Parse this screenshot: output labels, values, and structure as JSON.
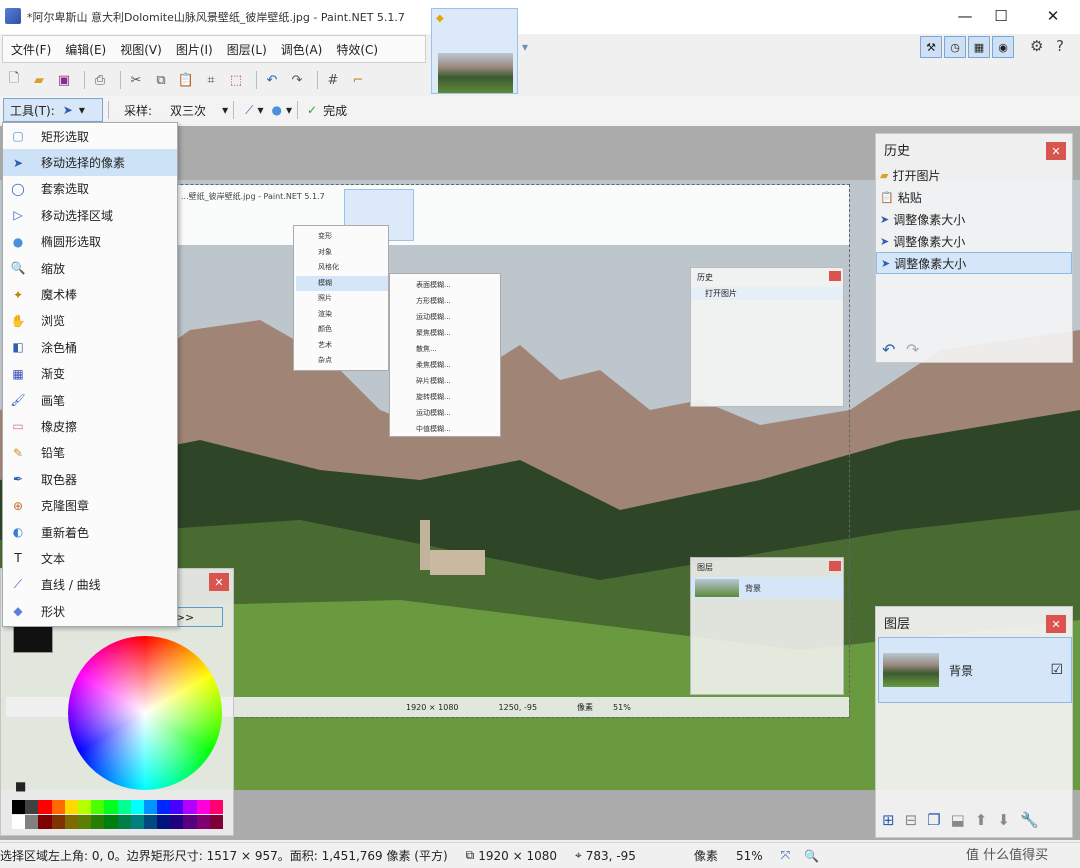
{
  "window": {
    "title": "*阿尔卑斯山 意大利Dolomite山脉风景壁纸_彼岸壁纸.jpg - Paint.NET 5.1.7",
    "minimize": "—",
    "maximize": "☐",
    "close": "✕"
  },
  "menu": [
    "文件(F)",
    "编辑(E)",
    "视图(V)",
    "图片(I)",
    "图层(L)",
    "调色(A)",
    "特效(C)"
  ],
  "toolbar2": {
    "tool_label": "工具(T):",
    "sampling_label": "采样:",
    "sampling_value": "双三次",
    "done_label": "完成"
  },
  "tools": [
    {
      "icon": "rect-select-icon",
      "label": "矩形选取"
    },
    {
      "icon": "move-pixels-icon",
      "label": "移动选择的像素"
    },
    {
      "icon": "lasso-icon",
      "label": "套索选取"
    },
    {
      "icon": "move-selection-icon",
      "label": "移动选择区域"
    },
    {
      "icon": "ellipse-select-icon",
      "label": "椭圆形选取"
    },
    {
      "icon": "zoom-icon",
      "label": "缩放"
    },
    {
      "icon": "magic-wand-icon",
      "label": "魔术棒"
    },
    {
      "icon": "pan-icon",
      "label": "浏览"
    },
    {
      "icon": "bucket-icon",
      "label": "涂色桶"
    },
    {
      "icon": "gradient-icon",
      "label": "渐变"
    },
    {
      "icon": "brush-icon",
      "label": "画笔"
    },
    {
      "icon": "eraser-icon",
      "label": "橡皮擦"
    },
    {
      "icon": "pencil-icon",
      "label": "铅笔"
    },
    {
      "icon": "picker-icon",
      "label": "取色器"
    },
    {
      "icon": "clone-stamp-icon",
      "label": "克隆图章"
    },
    {
      "icon": "recolor-icon",
      "label": "重新着色"
    },
    {
      "icon": "text-icon",
      "label": "文本"
    },
    {
      "icon": "line-icon",
      "label": "直线 / 曲线"
    },
    {
      "icon": "shapes-icon",
      "label": "形状"
    }
  ],
  "history": {
    "title": "历史",
    "items": [
      "打开图片",
      "粘贴",
      "调整像素大小",
      "调整像素大小",
      "调整像素大小"
    ]
  },
  "layers": {
    "title": "图层",
    "items": [
      {
        "name": "背景"
      }
    ]
  },
  "inner_ui": {
    "title": "...壁纸_彼岸壁纸.jpg - Paint.NET 5.1.7",
    "history_title": "历史",
    "history_item": "打开图片",
    "layers_title": "图层",
    "layer_name": "背景",
    "effects_menu": [
      "变形",
      "对象",
      "风格化",
      "模糊",
      "照片",
      "渲染",
      "颜色",
      "艺术",
      "杂点"
    ],
    "blur_menu": [
      "表面模糊...",
      "方形模糊...",
      "运动模糊...",
      "聚焦模糊...",
      "散焦...",
      "柔焦模糊...",
      "碎片模糊...",
      "旋转模糊...",
      "运动模糊...",
      "中值模糊..."
    ],
    "size": "1920 × 1080",
    "cursor": "1250, -95",
    "zoom_label": "像素",
    "zoom": "51%"
  },
  "colors_panel": {
    "more_btn": ">>"
  },
  "palette": [
    "#000000",
    "#404040",
    "#ff0000",
    "#ff6a00",
    "#ffd800",
    "#b6ff00",
    "#4cff00",
    "#00ff21",
    "#00ff90",
    "#00ffff",
    "#0094ff",
    "#0026ff",
    "#4800ff",
    "#b200ff",
    "#ff00dc",
    "#ff006e",
    "#ffffff",
    "#808080",
    "#7f0000",
    "#7f3300",
    "#7f6a00",
    "#5b7f00",
    "#267f00",
    "#007f0e",
    "#007f46",
    "#007f7f",
    "#004a7f",
    "#00137f",
    "#21007f",
    "#57007f",
    "#7f006e",
    "#7f0037"
  ],
  "statusbar": {
    "selection": "选择区域左上角: 0, 0。边界矩形尺寸: 1517 × 957。面积: 1,451,769 像素 (平方)",
    "image_size": "1920 × 1080",
    "cursor": "783, -95",
    "units": "像素",
    "zoom": "51%"
  },
  "watermark": "值 什么值得买"
}
